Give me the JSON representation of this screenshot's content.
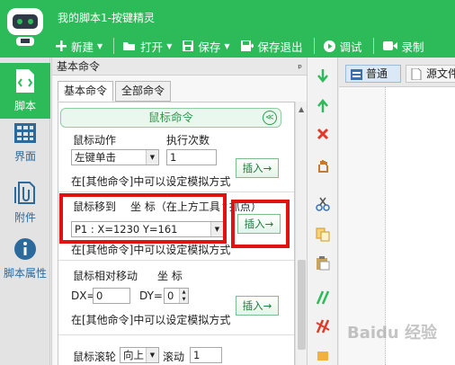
{
  "app": {
    "title": "我的脚本1-按键精灵"
  },
  "toolbar": {
    "new_label": "新建",
    "open_label": "打开",
    "save_label": "保存",
    "save_exit_label": "保存退出",
    "debug_label": "调试",
    "record_label": "录制"
  },
  "sidebar": {
    "items": [
      {
        "label": "脚本",
        "icon": "script-icon"
      },
      {
        "label": "界面",
        "icon": "grid-icon"
      },
      {
        "label": "附件",
        "icon": "attachment-icon"
      },
      {
        "label": "脚本属性",
        "icon": "info-icon"
      }
    ]
  },
  "panel": {
    "title": "基本命令",
    "pin": "ᵖ",
    "tabs": [
      "基本命令",
      "全部命令"
    ]
  },
  "mouse": {
    "group_title": "鼠标命令",
    "collapse": "≪",
    "action_label": "鼠标动作",
    "count_label": "执行次数",
    "action_value": "左键单击",
    "count_value": "1",
    "insert_label": "插入→",
    "note": "在[其他命令]中可以设定模拟方式",
    "move_label": "鼠标移到",
    "coord_label": "坐 标（在上方工具↑抓点）",
    "move_value": "P1 : X=1230 Y=161",
    "rel_label": "鼠标相对移动",
    "rel_coord_label": "坐 标",
    "dx_label": "DX=",
    "dx_value": "0",
    "dy_label": "DY=",
    "dy_value": "0",
    "wheel_label": "鼠标滚轮",
    "wheel_dir": "向上",
    "wheel_scroll_label": "滚动",
    "wheel_value": "1"
  },
  "editor": {
    "tab_normal": "普通",
    "tab_source": "源文件"
  },
  "watermark": "Baidu 经验",
  "colors": {
    "brand_green": "#2dbb5a",
    "highlight_red": "#e01313"
  }
}
